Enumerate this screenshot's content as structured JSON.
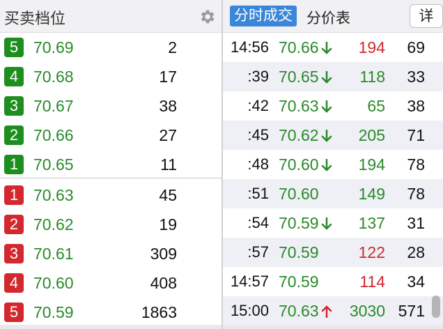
{
  "left_header": {
    "title": "买卖档位",
    "settings_icon": "gear-icon"
  },
  "order_book": [
    {
      "level": "5",
      "side": "sell",
      "color": "#1e8e1e",
      "price": "70.69",
      "volume": "2"
    },
    {
      "level": "4",
      "side": "sell",
      "color": "#1e8e1e",
      "price": "70.68",
      "volume": "17"
    },
    {
      "level": "3",
      "side": "sell",
      "color": "#1e8e1e",
      "price": "70.67",
      "volume": "38"
    },
    {
      "level": "2",
      "side": "sell",
      "color": "#1e8e1e",
      "price": "70.66",
      "volume": "27"
    },
    {
      "level": "1",
      "side": "sell",
      "color": "#1e8e1e",
      "price": "70.65",
      "volume": "11"
    },
    {
      "level": "1",
      "side": "buy",
      "color": "#d2282e",
      "price": "70.63",
      "volume": "45"
    },
    {
      "level": "2",
      "side": "buy",
      "color": "#d2282e",
      "price": "70.62",
      "volume": "19"
    },
    {
      "level": "3",
      "side": "buy",
      "color": "#d2282e",
      "price": "70.61",
      "volume": "309"
    },
    {
      "level": "4",
      "side": "buy",
      "color": "#d2282e",
      "price": "70.60",
      "volume": "408"
    },
    {
      "level": "5",
      "side": "buy",
      "color": "#d2282e",
      "price": "70.59",
      "volume": "1863"
    }
  ],
  "right_header": {
    "tab_active": "分时成交",
    "tab_price_table": "分价表",
    "detail_button": "详"
  },
  "trades": [
    {
      "time": "14:56",
      "price": "70.66",
      "arrow": "down",
      "volume": "194",
      "volume_color": "red",
      "count": "69"
    },
    {
      "time": ":39",
      "price": "70.65",
      "arrow": "down",
      "volume": "118",
      "volume_color": "green",
      "count": "33"
    },
    {
      "time": ":42",
      "price": "70.63",
      "arrow": "down",
      "volume": "65",
      "volume_color": "green",
      "count": "38"
    },
    {
      "time": ":45",
      "price": "70.62",
      "arrow": "down",
      "volume": "205",
      "volume_color": "green",
      "count": "71"
    },
    {
      "time": ":48",
      "price": "70.60",
      "arrow": "down",
      "volume": "194",
      "volume_color": "green",
      "count": "78"
    },
    {
      "time": ":51",
      "price": "70.60",
      "arrow": "none",
      "volume": "149",
      "volume_color": "green",
      "count": "78"
    },
    {
      "time": ":54",
      "price": "70.59",
      "arrow": "down",
      "volume": "137",
      "volume_color": "green",
      "count": "31"
    },
    {
      "time": ":57",
      "price": "70.59",
      "arrow": "none",
      "volume": "122",
      "volume_color": "red",
      "count": "28"
    },
    {
      "time": "14:57",
      "price": "70.59",
      "arrow": "none",
      "volume": "114",
      "volume_color": "red",
      "count": "34"
    },
    {
      "time": "15:00",
      "price": "70.63",
      "arrow": "up",
      "volume": "3030",
      "volume_color": "green",
      "count": "571"
    }
  ],
  "colors": {
    "up": "#d2282e",
    "down": "#2a8a2a",
    "accent": "#3a86d8"
  }
}
